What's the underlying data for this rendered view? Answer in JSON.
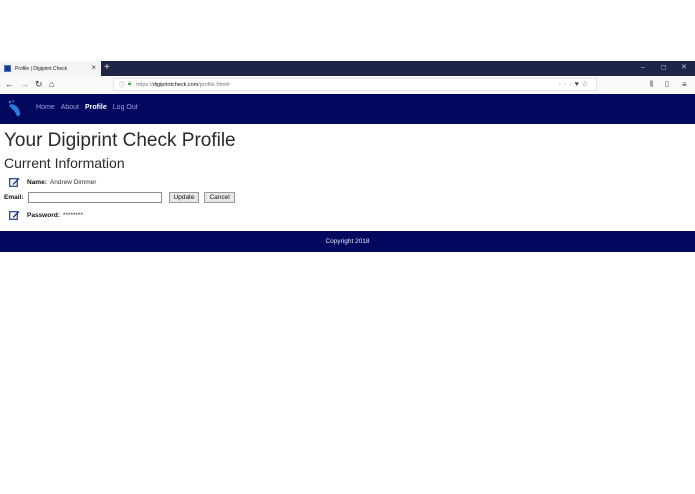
{
  "browser": {
    "tab_title": "Profile | Digiprint Check",
    "new_tab": "+",
    "url_prefix": "https://",
    "url_host": "digiprintcheck.com",
    "url_path": "/profile.html#",
    "more_actions": "···"
  },
  "site": {
    "nav": [
      "Home",
      "About",
      "Profile",
      "Log Out"
    ],
    "active_nav": "Profile"
  },
  "page": {
    "title": "Your Digiprint Check Profile",
    "section_title": "Current Information",
    "name_label": "Name:",
    "name_value": "Andrew Dimmer",
    "email_label": "Email:",
    "email_value": "",
    "update_label": "Update",
    "cancel_label": "Cancel",
    "password_label": "Password:",
    "password_value": "********"
  },
  "footer": {
    "text": "Copyright 2018"
  },
  "colors": {
    "header": "#01085e",
    "browser_tabbar": "#1f2546"
  },
  "icons": [
    "back-arrow-icon",
    "forward-arrow-icon",
    "reload-icon",
    "home-icon",
    "info-icon",
    "lock-icon",
    "pocket-icon",
    "star-icon",
    "library-icon",
    "sidebar-icon",
    "menu-icon",
    "edit-icon"
  ]
}
